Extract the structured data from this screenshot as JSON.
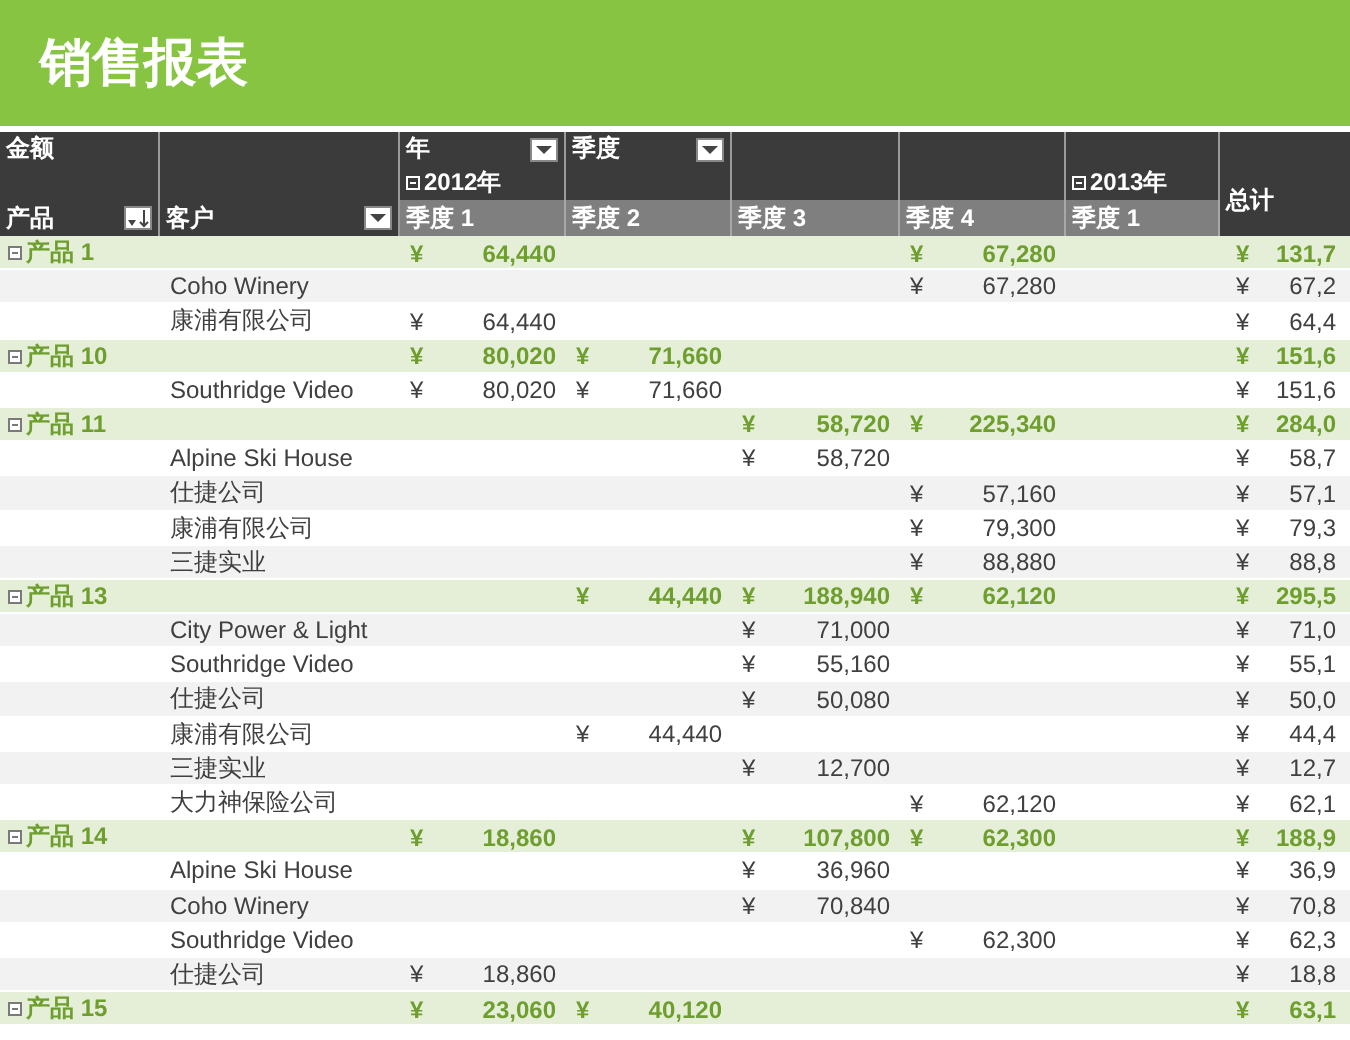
{
  "title": "销售报表",
  "header": {
    "value_field": "金额",
    "filters": [
      {
        "label": "年",
        "kind": "dropdown"
      },
      {
        "label": "季度",
        "kind": "dropdown"
      }
    ],
    "row_fields": [
      {
        "label": "产品",
        "kind": "sorted"
      },
      {
        "label": "客户",
        "kind": "dropdown"
      }
    ],
    "years": [
      {
        "label": "2012年",
        "expanded": true
      },
      {
        "label": "2013年",
        "expanded": true
      }
    ],
    "quarters": [
      "季度 1",
      "季度 2",
      "季度 3",
      "季度 4",
      "季度 1"
    ],
    "total_label": "总计"
  },
  "rows": [
    {
      "kind": "product",
      "label": "产品 1",
      "expanded": true,
      "values": {
        "y2012_q1": {
          "currency": "¥",
          "amount": "64,440"
        },
        "y2012_q4": {
          "currency": "¥",
          "amount": "67,280"
        },
        "total": {
          "currency": "¥",
          "amount": "131,7"
        }
      }
    },
    {
      "kind": "customer",
      "label": "Coho Winery",
      "values": {
        "y2012_q4": {
          "currency": "¥",
          "amount": "67,280"
        },
        "total": {
          "currency": "¥",
          "amount": "67,2"
        }
      }
    },
    {
      "kind": "customer",
      "label": "康浦有限公司",
      "values": {
        "y2012_q1": {
          "currency": "¥",
          "amount": "64,440"
        },
        "total": {
          "currency": "¥",
          "amount": "64,4"
        }
      }
    },
    {
      "kind": "product",
      "label": "产品 10",
      "expanded": true,
      "values": {
        "y2012_q1": {
          "currency": "¥",
          "amount": "80,020"
        },
        "y2012_q2": {
          "currency": "¥",
          "amount": "71,660"
        },
        "total": {
          "currency": "¥",
          "amount": "151,6"
        }
      }
    },
    {
      "kind": "customer",
      "label": "Southridge Video",
      "values": {
        "y2012_q1": {
          "currency": "¥",
          "amount": "80,020"
        },
        "y2012_q2": {
          "currency": "¥",
          "amount": "71,660"
        },
        "total": {
          "currency": "¥",
          "amount": "151,6"
        }
      }
    },
    {
      "kind": "product",
      "label": "产品 11",
      "expanded": true,
      "values": {
        "y2012_q3": {
          "currency": "¥",
          "amount": "58,720"
        },
        "y2012_q4": {
          "currency": "¥",
          "amount": "225,340"
        },
        "total": {
          "currency": "¥",
          "amount": "284,0"
        }
      }
    },
    {
      "kind": "customer",
      "label": "Alpine Ski House",
      "values": {
        "y2012_q3": {
          "currency": "¥",
          "amount": "58,720"
        },
        "total": {
          "currency": "¥",
          "amount": "58,7"
        }
      }
    },
    {
      "kind": "customer",
      "label": "仕捷公司",
      "values": {
        "y2012_q4": {
          "currency": "¥",
          "amount": "57,160"
        },
        "total": {
          "currency": "¥",
          "amount": "57,1"
        }
      }
    },
    {
      "kind": "customer",
      "label": "康浦有限公司",
      "values": {
        "y2012_q4": {
          "currency": "¥",
          "amount": "79,300"
        },
        "total": {
          "currency": "¥",
          "amount": "79,3"
        }
      }
    },
    {
      "kind": "customer",
      "label": "三捷实业",
      "values": {
        "y2012_q4": {
          "currency": "¥",
          "amount": "88,880"
        },
        "total": {
          "currency": "¥",
          "amount": "88,8"
        }
      }
    },
    {
      "kind": "product",
      "label": "产品 13",
      "expanded": true,
      "values": {
        "y2012_q2": {
          "currency": "¥",
          "amount": "44,440"
        },
        "y2012_q3": {
          "currency": "¥",
          "amount": "188,940"
        },
        "y2012_q4": {
          "currency": "¥",
          "amount": "62,120"
        },
        "total": {
          "currency": "¥",
          "amount": "295,5"
        }
      }
    },
    {
      "kind": "customer",
      "label": "City Power & Light",
      "values": {
        "y2012_q3": {
          "currency": "¥",
          "amount": "71,000"
        },
        "total": {
          "currency": "¥",
          "amount": "71,0"
        }
      }
    },
    {
      "kind": "customer",
      "label": "Southridge Video",
      "values": {
        "y2012_q3": {
          "currency": "¥",
          "amount": "55,160"
        },
        "total": {
          "currency": "¥",
          "amount": "55,1"
        }
      }
    },
    {
      "kind": "customer",
      "label": "仕捷公司",
      "values": {
        "y2012_q3": {
          "currency": "¥",
          "amount": "50,080"
        },
        "total": {
          "currency": "¥",
          "amount": "50,0"
        }
      }
    },
    {
      "kind": "customer",
      "label": "康浦有限公司",
      "values": {
        "y2012_q2": {
          "currency": "¥",
          "amount": "44,440"
        },
        "total": {
          "currency": "¥",
          "amount": "44,4"
        }
      }
    },
    {
      "kind": "customer",
      "label": "三捷实业",
      "values": {
        "y2012_q3": {
          "currency": "¥",
          "amount": "12,700"
        },
        "total": {
          "currency": "¥",
          "amount": "12,7"
        }
      }
    },
    {
      "kind": "customer",
      "label": "大力神保险公司",
      "values": {
        "y2012_q4": {
          "currency": "¥",
          "amount": "62,120"
        },
        "total": {
          "currency": "¥",
          "amount": "62,1"
        }
      }
    },
    {
      "kind": "product",
      "label": "产品 14",
      "expanded": true,
      "values": {
        "y2012_q1": {
          "currency": "¥",
          "amount": "18,860"
        },
        "y2012_q3": {
          "currency": "¥",
          "amount": "107,800"
        },
        "y2012_q4": {
          "currency": "¥",
          "amount": "62,300"
        },
        "total": {
          "currency": "¥",
          "amount": "188,9"
        }
      }
    },
    {
      "kind": "customer",
      "label": "Alpine Ski House",
      "values": {
        "y2012_q3": {
          "currency": "¥",
          "amount": "36,960"
        },
        "total": {
          "currency": "¥",
          "amount": "36,9"
        }
      }
    },
    {
      "kind": "customer",
      "label": "Coho Winery",
      "values": {
        "y2012_q3": {
          "currency": "¥",
          "amount": "70,840"
        },
        "total": {
          "currency": "¥",
          "amount": "70,8"
        }
      }
    },
    {
      "kind": "customer",
      "label": "Southridge Video",
      "values": {
        "y2012_q4": {
          "currency": "¥",
          "amount": "62,300"
        },
        "total": {
          "currency": "¥",
          "amount": "62,3"
        }
      }
    },
    {
      "kind": "customer",
      "label": "仕捷公司",
      "values": {
        "y2012_q1": {
          "currency": "¥",
          "amount": "18,860"
        },
        "total": {
          "currency": "¥",
          "amount": "18,8"
        }
      }
    },
    {
      "kind": "product",
      "label": "产品 15",
      "expanded": true,
      "values": {
        "y2012_q1": {
          "currency": "¥",
          "amount": "23,060"
        },
        "y2012_q2": {
          "currency": "¥",
          "amount": "40,120"
        },
        "total": {
          "currency": "¥",
          "amount": "63,1"
        }
      }
    }
  ]
}
